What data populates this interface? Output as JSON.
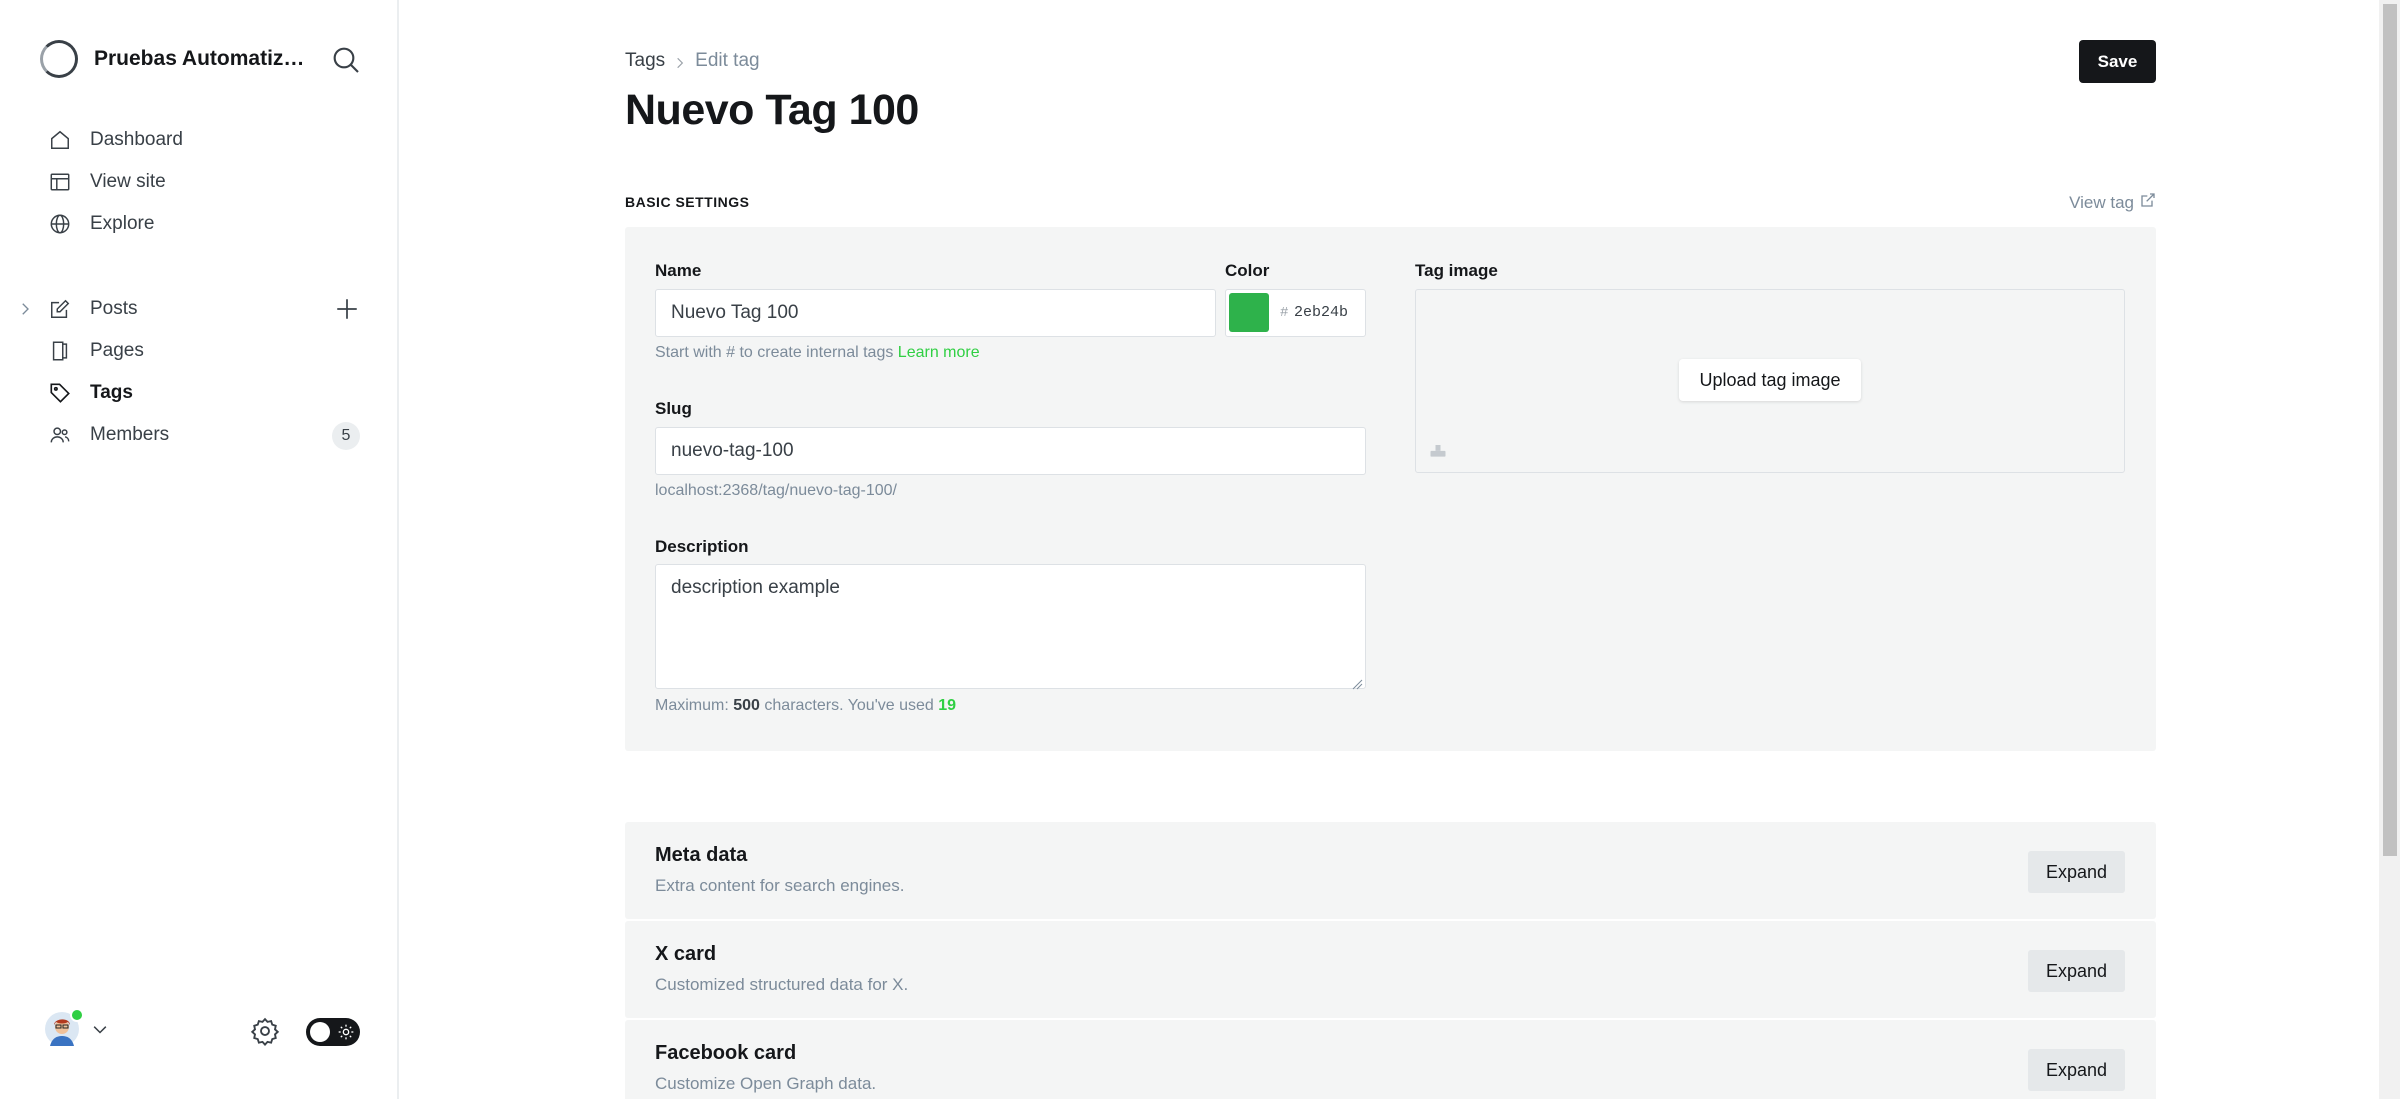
{
  "sidebar": {
    "site_title": "Pruebas Automatizad...",
    "nav_top": [
      {
        "label": "Dashboard",
        "icon": "home-icon"
      },
      {
        "label": "View site",
        "icon": "layout-icon"
      },
      {
        "label": "Explore",
        "icon": "globe-icon"
      }
    ],
    "nav_main": [
      {
        "label": "Posts",
        "icon": "edit-icon"
      },
      {
        "label": "Pages",
        "icon": "page-icon"
      },
      {
        "label": "Tags",
        "icon": "tag-icon",
        "active": true
      },
      {
        "label": "Members",
        "icon": "members-icon",
        "count": "5"
      }
    ]
  },
  "breadcrumb": {
    "parent": "Tags",
    "current": "Edit tag"
  },
  "page": {
    "title": "Nuevo Tag 100",
    "save_label": "Save"
  },
  "basic_settings": {
    "section_title": "BASIC SETTINGS",
    "view_tag_label": "View tag",
    "name_label": "Name",
    "name_value": "Nuevo Tag 100",
    "name_hint": "Start with # to create internal tags",
    "learn_more": "Learn more",
    "color_label": "Color",
    "color_hash": "#",
    "color_value": "2eb24b",
    "color_hex": "#2eb24b",
    "slug_label": "Slug",
    "slug_value": "nuevo-tag-100",
    "slug_url": "localhost:2368/tag/nuevo-tag-100/",
    "description_label": "Description",
    "description_value": "description example",
    "desc_hint_prefix": "Maximum:",
    "desc_max": "500",
    "desc_hint_mid": "characters. You've used",
    "desc_used": "19",
    "tag_image_label": "Tag image",
    "upload_label": "Upload tag image"
  },
  "sections": [
    {
      "title": "Meta data",
      "subtitle": "Extra content for search engines.",
      "button": "Expand"
    },
    {
      "title": "X card",
      "subtitle": "Customized structured data for X.",
      "button": "Expand"
    },
    {
      "title": "Facebook card",
      "subtitle": "Customize Open Graph data.",
      "button": "Expand"
    }
  ],
  "colors": {
    "accent_green": "#30cf43",
    "dark": "#15171a"
  }
}
